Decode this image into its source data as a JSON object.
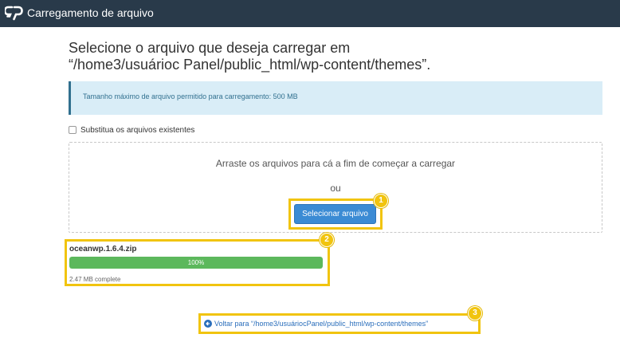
{
  "app": {
    "title": "Carregamento de arquivo",
    "logo_icon": "cpanel-logo-icon"
  },
  "heading": {
    "line1": "Selecione o arquivo que deseja carregar em",
    "line2": "“/home3/usuárioc Panel/public_html/wp-content/themes”."
  },
  "info": {
    "text": "Tamanho máximo de arquivo permitido para carregamento: 500 MB"
  },
  "overwrite": {
    "label": "Substitua os arquivos existentes",
    "checked": false
  },
  "dropzone": {
    "text": "Arraste os arquivos para cá a fim de começar a carregar",
    "or": "ou",
    "button_label": "Selecionar arquivo"
  },
  "upload": {
    "file_name": "oceanwp.1.6.4.zip",
    "progress_text": "100%",
    "progress": 1.0,
    "status": "2.47 MB complete"
  },
  "back": {
    "icon": "arrow-left-circle-icon",
    "text": "Voltar para “/home3/usuáriocPanel/public_html/wp-content/themes”"
  },
  "callouts": [
    "1",
    "2",
    "3"
  ],
  "colors": {
    "topbar": "#293a4a",
    "info_bg": "#d9edf7",
    "button": "#3b8bd4",
    "progress": "#5cb85c",
    "highlight": "#f1c40f",
    "link": "#2a6ebb"
  }
}
